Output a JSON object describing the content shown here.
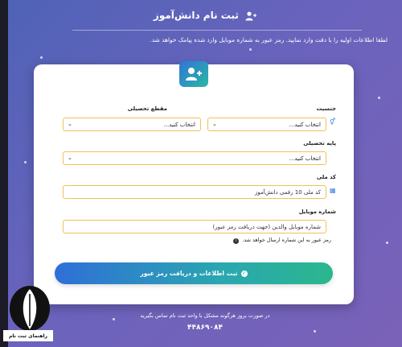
{
  "page": {
    "title": "ثبت نام دانش‌آموز",
    "intro": "لطفا اطلاعات اولیه را با دقت وارد نمایید. رمز عبور به شماره موبایل وارد شده پیامک خواهد شد."
  },
  "form": {
    "gender": {
      "label": "جنسیت",
      "value": "انتخاب کنید..."
    },
    "grade": {
      "label": "مقطع تحصیلی",
      "value": "انتخاب کنید..."
    },
    "base": {
      "label": "پایه تحصیلی",
      "value": "انتخاب کنید..."
    },
    "national_code": {
      "label": "کد ملی",
      "placeholder": "کد ملی 10 رقمی دانش‌آموز"
    },
    "mobile": {
      "label": "شماره موبایل",
      "placeholder": "شماره موبایل والدین (جهت دریافت رمز عبور)",
      "hint": "رمز عبور به این شماره ارسال خواهد شد."
    },
    "submit_label": "ثبت اطلاعات و دریافت رمز عبور"
  },
  "footer": {
    "note": "در صورت بروز هرگونه مشکل با واحد ثبت نام تماس بگیرید",
    "phone": "۴۴۸۶۹۰۸۴"
  },
  "watermark": {
    "text": "راهنمای ثبت نام"
  },
  "colors": {
    "accent": "#2f76d6",
    "field_border": "#f0c15a",
    "submit_end": "#2bb78e"
  }
}
